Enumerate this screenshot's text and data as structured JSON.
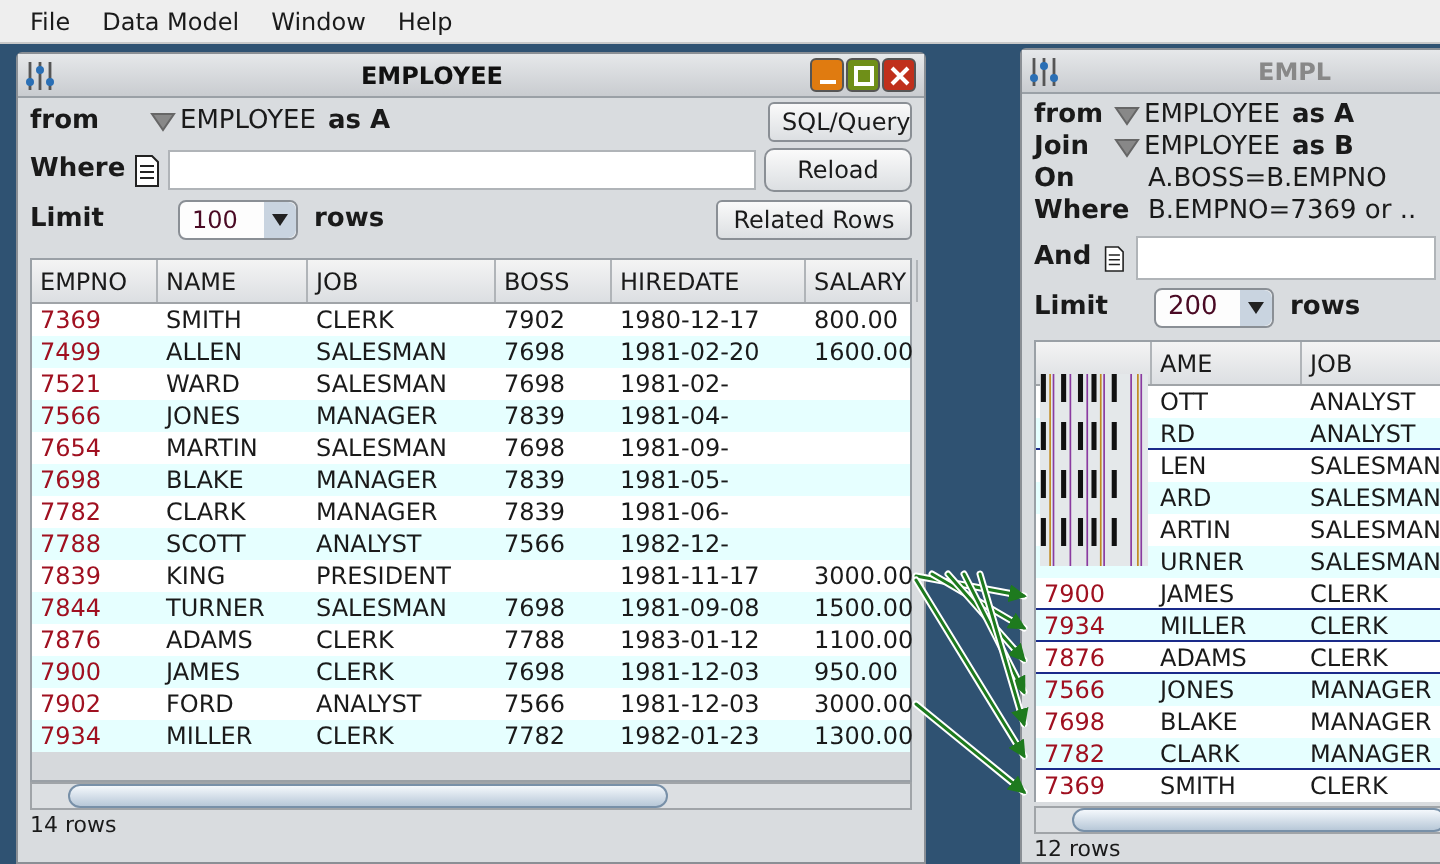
{
  "menu": [
    "File",
    "Data Model",
    "Window",
    "Help"
  ],
  "left_window": {
    "title": "EMPLOYEE",
    "from_label": "from",
    "from_table": "EMPLOYEE",
    "from_alias": "as A",
    "where_label": "Where",
    "limit_label": "Limit",
    "limit_value": "100",
    "rows_label": "rows",
    "buttons": [
      "SQL/Query",
      "Reload",
      "Related Rows"
    ],
    "table": {
      "columns": [
        "EMPNO",
        "NAME",
        "JOB",
        "BOSS",
        "HIREDATE",
        "SALARY"
      ],
      "rows": [
        [
          "7369",
          "SMITH",
          "CLERK",
          "7902",
          "1980-12-17",
          "800.00"
        ],
        [
          "7499",
          "ALLEN",
          "SALESMAN",
          "7698",
          "1981-02-20",
          "1600.00"
        ],
        [
          "7521",
          "WARD",
          "SALESMAN",
          "7698",
          "1981-02-",
          ""
        ],
        [
          "7566",
          "JONES",
          "MANAGER",
          "7839",
          "1981-04-",
          ""
        ],
        [
          "7654",
          "MARTIN",
          "SALESMAN",
          "7698",
          "1981-09-",
          ""
        ],
        [
          "7698",
          "BLAKE",
          "MANAGER",
          "7839",
          "1981-05-",
          ""
        ],
        [
          "7782",
          "CLARK",
          "MANAGER",
          "7839",
          "1981-06-",
          ""
        ],
        [
          "7788",
          "SCOTT",
          "ANALYST",
          "7566",
          "1982-12-",
          ""
        ],
        [
          "7839",
          "KING",
          "PRESIDENT",
          "",
          "1981-11-17",
          "3000.00"
        ],
        [
          "7844",
          "TURNER",
          "SALESMAN",
          "7698",
          "1981-09-08",
          "1500.00"
        ],
        [
          "7876",
          "ADAMS",
          "CLERK",
          "7788",
          "1983-01-12",
          "1100.00"
        ],
        [
          "7900",
          "JAMES",
          "CLERK",
          "7698",
          "1981-12-03",
          "950.00"
        ],
        [
          "7902",
          "FORD",
          "ANALYST",
          "7566",
          "1981-12-03",
          "3000.00"
        ],
        [
          "7934",
          "MILLER",
          "CLERK",
          "7782",
          "1982-01-23",
          "1300.00"
        ]
      ]
    },
    "status": "14 rows"
  },
  "right_window": {
    "title": "EMPL",
    "from_label": "from",
    "from_table": "EMPLOYEE",
    "from_alias": "as A",
    "join_label": "Join",
    "join_table": "EMPLOYEE",
    "join_alias": "as B",
    "on_label": "On",
    "on_value": "A.BOSS=B.EMPNO",
    "where_label": "Where",
    "where_value": "B.EMPNO=7369 or ..",
    "and_label": "And",
    "limit_label": "Limit",
    "limit_value": "200",
    "rows_label": "rows",
    "table": {
      "columns": [
        "",
        "AME",
        "JOB"
      ],
      "rows": [
        {
          "cells": [
            "",
            "OTT",
            "ANALYST"
          ],
          "divider_below": false
        },
        {
          "cells": [
            "",
            "RD",
            "ANALYST"
          ],
          "divider_below": true
        },
        {
          "cells": [
            "",
            "LEN",
            "SALESMAN"
          ],
          "divider_below": false
        },
        {
          "cells": [
            "",
            "ARD",
            "SALESMAN"
          ],
          "divider_below": false
        },
        {
          "cells": [
            "",
            "ARTIN",
            "SALESMAN"
          ],
          "divider_below": false
        },
        {
          "cells": [
            "",
            "URNER",
            "SALESMAN"
          ],
          "divider_below": false
        },
        {
          "cells": [
            "7900",
            "JAMES",
            "CLERK"
          ],
          "divider_below": true
        },
        {
          "cells": [
            "7934",
            "MILLER",
            "CLERK"
          ],
          "divider_below": true
        },
        {
          "cells": [
            "7876",
            "ADAMS",
            "CLERK"
          ],
          "divider_below": true
        },
        {
          "cells": [
            "7566",
            "JONES",
            "MANAGER"
          ],
          "divider_below": false
        },
        {
          "cells": [
            "7698",
            "BLAKE",
            "MANAGER"
          ],
          "divider_below": false
        },
        {
          "cells": [
            "7782",
            "CLARK",
            "MANAGER"
          ],
          "divider_below": true
        },
        {
          "cells": [
            "7369",
            "SMITH",
            "CLERK"
          ],
          "divider_below": false
        }
      ]
    },
    "status": "12 rows"
  }
}
